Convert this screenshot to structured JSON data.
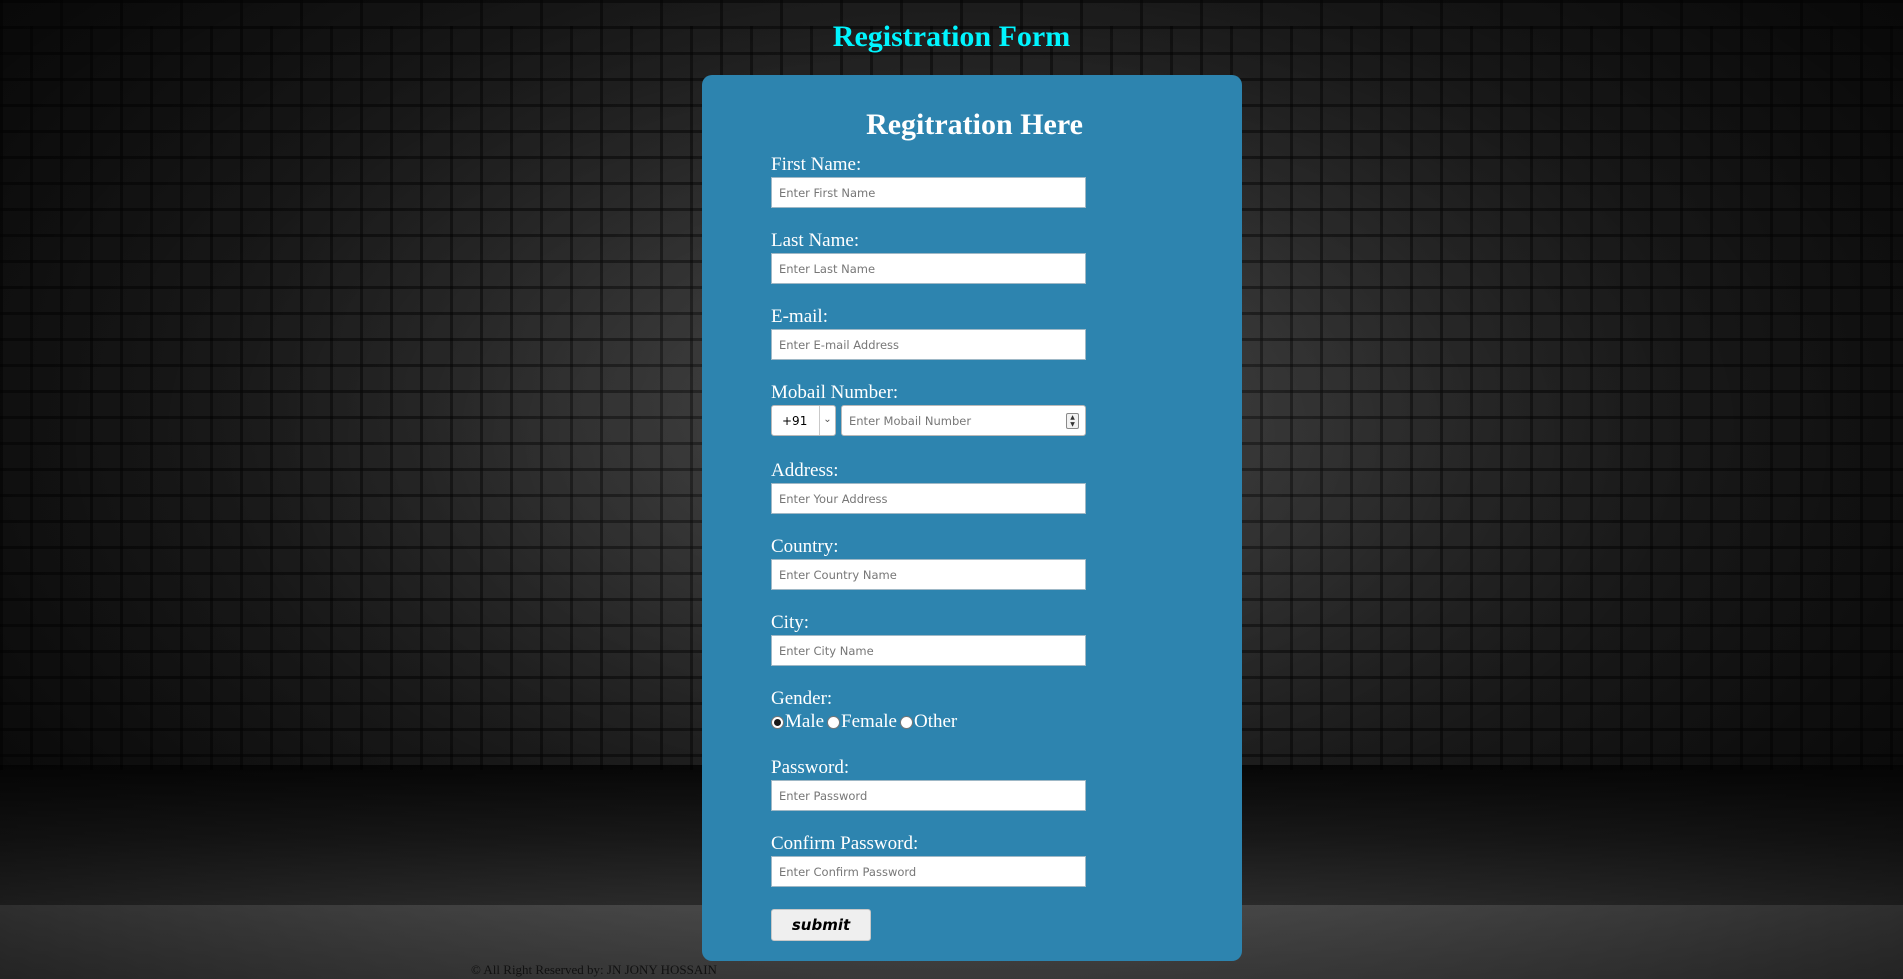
{
  "page_title": "Registration Form",
  "form": {
    "heading": "Regitration Here",
    "fields": [
      {
        "label": "First Name:",
        "placeholder": "Enter First Name"
      },
      {
        "label": "Last Name:",
        "placeholder": "Enter Last Name"
      },
      {
        "label": "E-mail:",
        "placeholder": "Enter E-mail Address"
      },
      {
        "label": "Mobail Number:",
        "code": "+91",
        "placeholder": "Enter Mobail Number"
      },
      {
        "label": "Address:",
        "placeholder": "Enter Your Address"
      },
      {
        "label": "Country:",
        "placeholder": "Enter Country Name"
      },
      {
        "label": "City:",
        "placeholder": "Enter City Name"
      },
      {
        "label": "Gender:",
        "options": [
          "Male",
          "Female",
          "Other"
        ],
        "selected": "Male"
      },
      {
        "label": "Password:",
        "placeholder": "Enter Password"
      },
      {
        "label": "Confirm Password:",
        "placeholder": "Enter Confirm Password"
      }
    ],
    "submit_label": "submit"
  },
  "footer": "© All Right Reserved by:  JN JONY HOSSAIN",
  "colors": {
    "title": "#00f5ff",
    "card": "#2d84af",
    "label": "#ffffff"
  }
}
